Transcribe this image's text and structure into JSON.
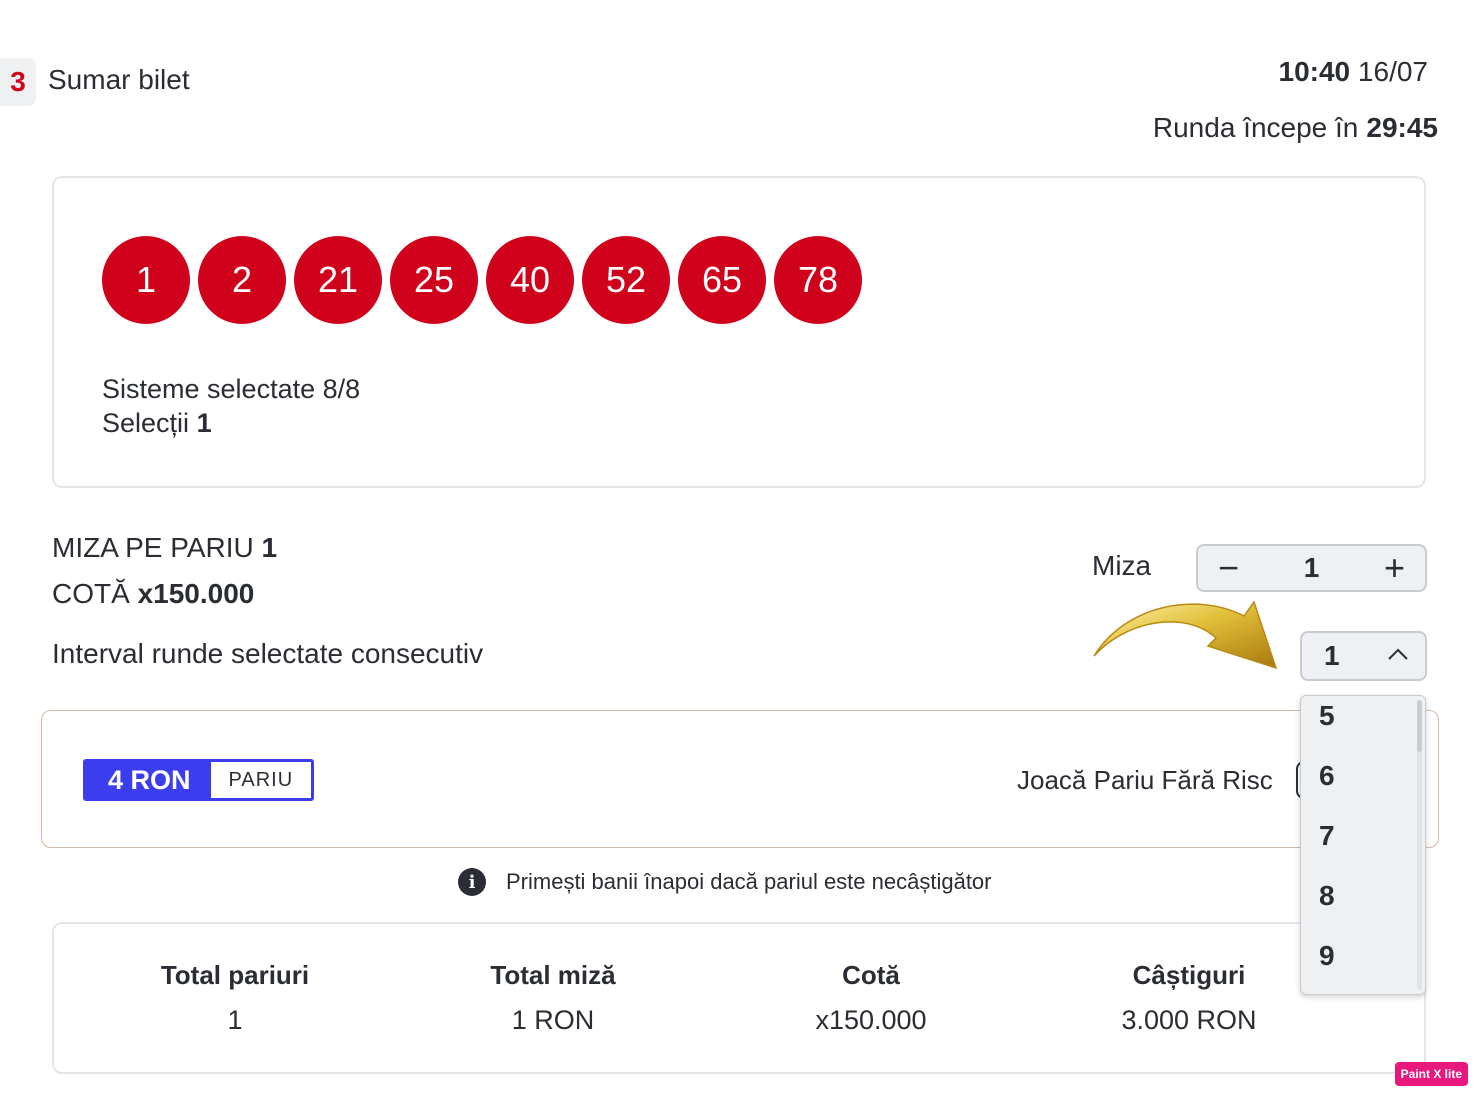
{
  "header": {
    "step_number": "3",
    "step_title": "Sumar bilet",
    "time": "10:40",
    "date": "16/07",
    "countdown_label": "Runda începe în",
    "countdown_value": "29:45"
  },
  "selection": {
    "numbers": [
      "1",
      "2",
      "21",
      "25",
      "40",
      "52",
      "65",
      "78"
    ],
    "systems_label": "Sisteme selectate 8/8",
    "selections_label": "Selecții",
    "selections_value": "1"
  },
  "bet": {
    "stake_per_bet_label": "MIZA PE PARIU",
    "stake_per_bet_value": "1",
    "odds_label": "COTĂ",
    "odds_value": "x150.000",
    "interval_label": "Interval runde selectate consecutiv"
  },
  "stake_control": {
    "label": "Miza",
    "minus": "−",
    "value": "1",
    "plus": "+"
  },
  "rounds_select": {
    "selected": "1",
    "options_visible": [
      "5",
      "6",
      "7",
      "8",
      "9"
    ]
  },
  "promo": {
    "amount": "4 RON",
    "tag": "PARIU",
    "text": "Joacă Pariu Fără Risc"
  },
  "info": {
    "icon": "info-icon",
    "text": "Primești banii înapoi dacă pariul este necâștigător"
  },
  "totals": [
    {
      "label": "Total pariuri",
      "value": "1"
    },
    {
      "label": "Total miză",
      "value": "1 RON"
    },
    {
      "label": "Cotă",
      "value": "x150.000"
    },
    {
      "label": "Câștiguri",
      "value": "3.000 RON"
    }
  ],
  "watermark": "Paint X lite",
  "colors": {
    "accent_red": "#d0021b",
    "promo_blue": "#3d3df0",
    "arrow_gold": "#d4a71c"
  }
}
